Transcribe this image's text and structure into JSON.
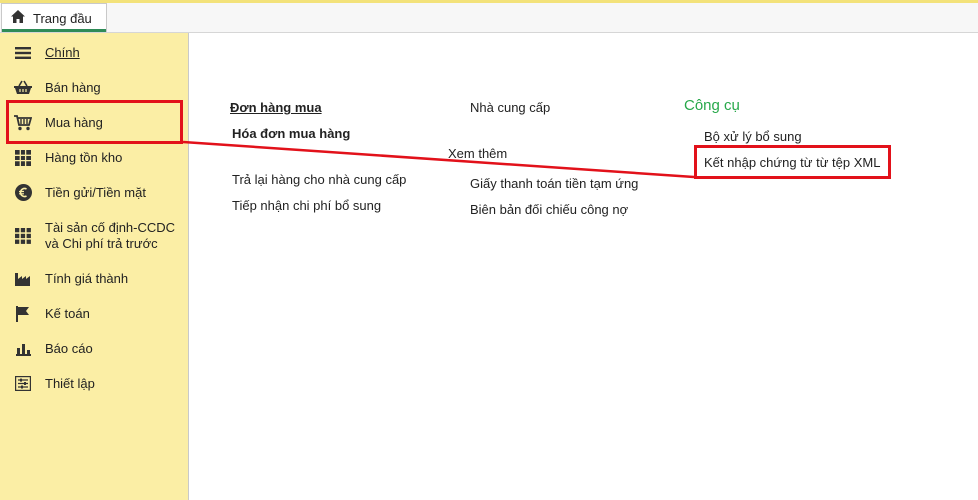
{
  "topbar": {
    "home_tab": "Trang đầu"
  },
  "sidebar": {
    "items": [
      {
        "label": "Chính",
        "icon": "list-icon"
      },
      {
        "label": "Bán hàng",
        "icon": "basket-icon"
      },
      {
        "label": "Mua hàng",
        "icon": "cart-icon"
      },
      {
        "label": "Hàng tồn kho",
        "icon": "grid-icon"
      },
      {
        "label": "Tiền gửi/Tiền mặt",
        "icon": "euro-icon"
      },
      {
        "label": "Tài sản cố định-CCDC\nvà Chi phí trả trước",
        "icon": "grid-icon"
      },
      {
        "label": "Tính giá thành",
        "icon": "factory-icon"
      },
      {
        "label": "Kế toán",
        "icon": "flag-icon"
      },
      {
        "label": "Báo cáo",
        "icon": "bar-chart-icon"
      },
      {
        "label": "Thiết lập",
        "icon": "settings-icon"
      }
    ]
  },
  "main": {
    "col1": {
      "links": [
        "Đơn hàng mua",
        "Hóa đơn mua hàng",
        "Trả lại hàng cho nhà cung cấp",
        "Tiếp nhận chi phí bổ sung"
      ],
      "see_more": "Xem thêm"
    },
    "col2": {
      "links": [
        "Nhà cung cấp",
        "Giấy thanh toán tiền tạm ứng",
        "Biên bản đối chiếu công nợ"
      ]
    },
    "col3": {
      "heading": "Công cụ",
      "links": [
        "Bộ xử lý bổ sung",
        "Kết nhập chứng từ từ tệp XML"
      ]
    }
  },
  "colors": {
    "sidebar_bg": "#fbeea5",
    "highlight": "#e2111a",
    "heading": "#27a84a",
    "tab_accent": "#2e8b57"
  }
}
